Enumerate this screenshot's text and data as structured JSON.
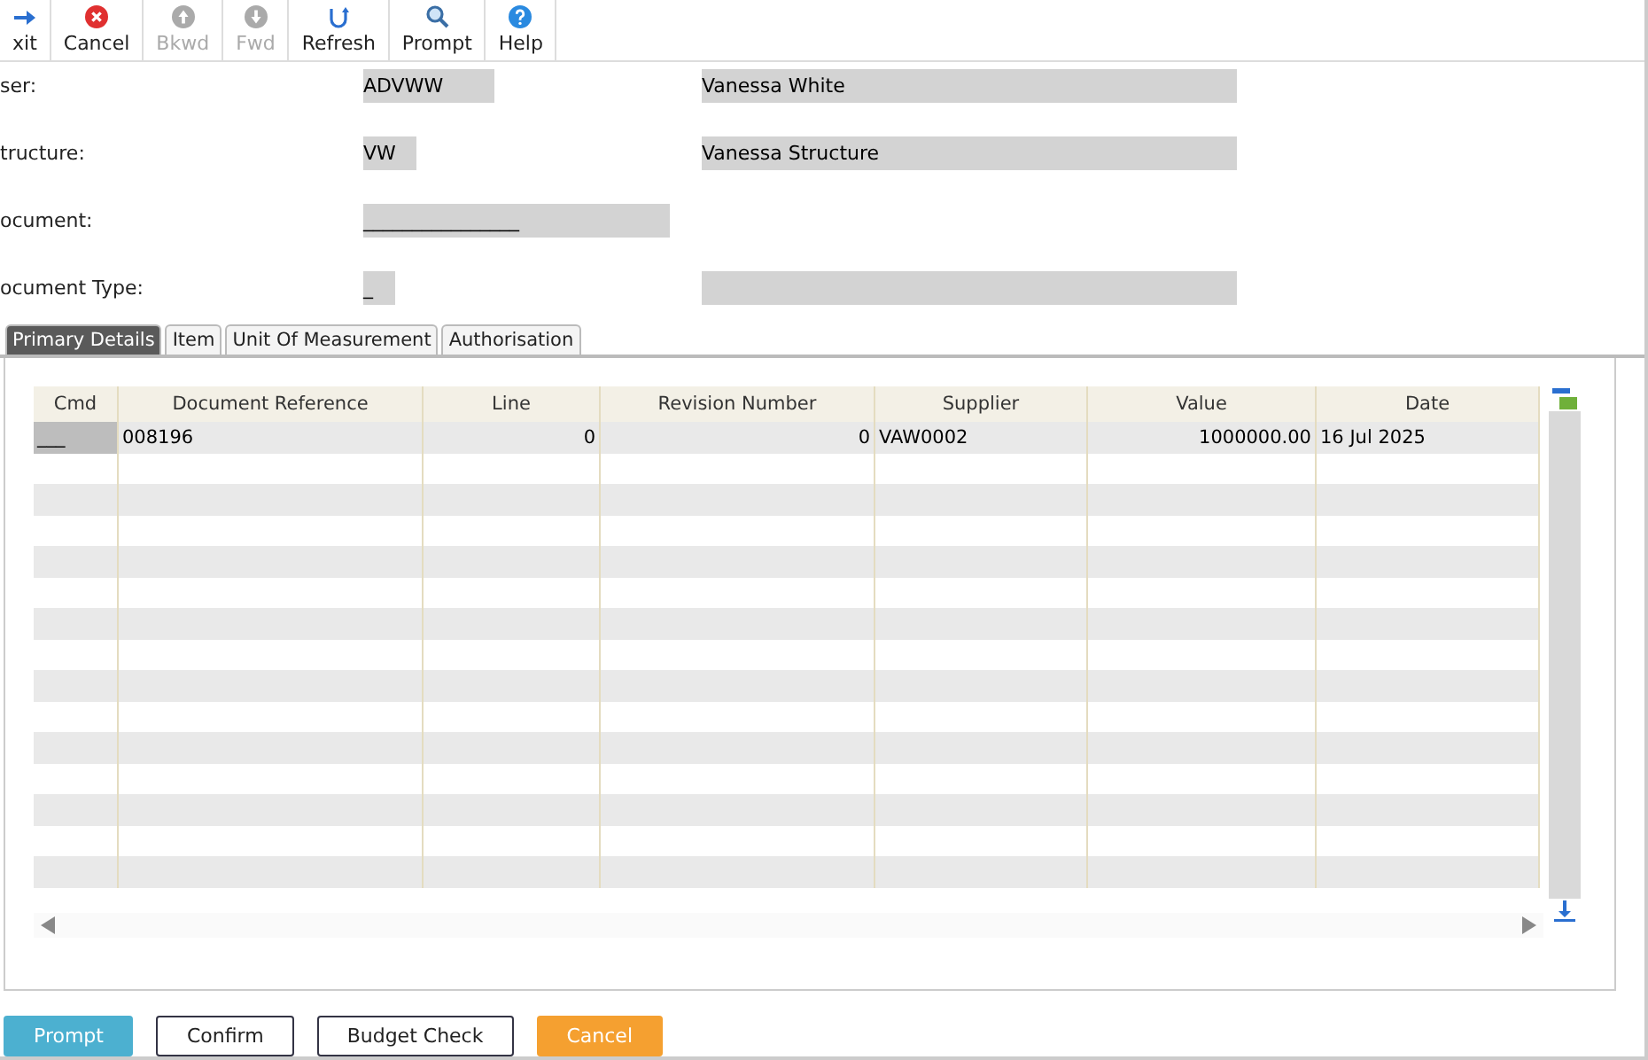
{
  "toolbar": [
    {
      "label": "xit",
      "kind": "exit",
      "disabled": false
    },
    {
      "label": "Cancel",
      "kind": "cancel",
      "disabled": false
    },
    {
      "label": "Bkwd",
      "kind": "up",
      "disabled": true
    },
    {
      "label": "Fwd",
      "kind": "down",
      "disabled": true
    },
    {
      "label": "Refresh",
      "kind": "refresh",
      "disabled": false
    },
    {
      "label": "Prompt",
      "kind": "search",
      "disabled": false
    },
    {
      "label": "Help",
      "kind": "help",
      "disabled": false
    }
  ],
  "form": [
    {
      "label": "ser:",
      "code": "ADVWW",
      "name": "Vanessa White",
      "kind": "pair"
    },
    {
      "label": "tructure:",
      "code": "VW",
      "name": "Vanessa Structure",
      "kind": "pair"
    },
    {
      "label": "ocument:",
      "code": "________________",
      "kind": "single"
    },
    {
      "label": "ocument Type:",
      "code": "_",
      "kind": "pair"
    }
  ],
  "tabs": [
    {
      "label": "Primary Details",
      "selected": true
    },
    {
      "label": "Item",
      "selected": false
    },
    {
      "label": "Unit Of Measurement",
      "selected": false
    },
    {
      "label": "Authorisation",
      "selected": false
    }
  ],
  "table": {
    "columns": [
      "Cmd",
      "Document Reference",
      "Line",
      "Revision Number",
      "Supplier",
      "Value",
      "Date"
    ],
    "rows": [
      [
        "___",
        "008196",
        "0",
        "0",
        "VAW0002",
        "1000000.00",
        "16 Jul 2025"
      ]
    ]
  },
  "buttons": [
    {
      "label": "Prompt",
      "kind": "primary"
    },
    {
      "label": "Confirm",
      "kind": "plain"
    },
    {
      "label": "Budget Check",
      "kind": "plain"
    },
    {
      "label": "Cancel",
      "kind": "warning"
    }
  ]
}
